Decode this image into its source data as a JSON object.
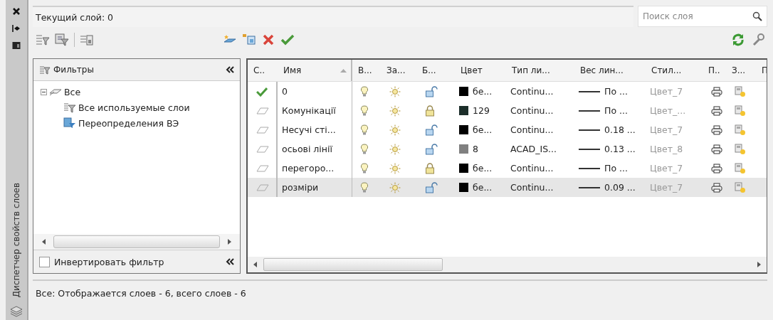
{
  "side_panel": {
    "title": "Диспетчер свойств слоев"
  },
  "current_layer": {
    "value": "Текущий слой: 0"
  },
  "search": {
    "placeholder": "Поиск слоя"
  },
  "filters": {
    "title": "Фильтры",
    "tree": [
      {
        "label": "Все",
        "kind": "all",
        "expanded": true,
        "children": [
          {
            "label": "Все используемые слои",
            "kind": "filter"
          },
          {
            "label": "Переопределения ВЭ",
            "kind": "override"
          }
        ]
      }
    ],
    "invert": {
      "label": "Инвертировать фильтр",
      "checked": false
    }
  },
  "table": {
    "columns": [
      "С..",
      "Имя",
      "В...",
      "За...",
      "Б...",
      "Цвет",
      "Тип ли...",
      "Вес лин...",
      "Стил...",
      "П..",
      "З...",
      "П"
    ],
    "rows": [
      {
        "kind": "current",
        "name": "0",
        "on": true,
        "frozen": false,
        "locked": false,
        "color": "#000000",
        "color_label": "бе...",
        "linetype": "Continu...",
        "lineweight": "По ...",
        "plot_style": "Цвет_7",
        "plot": true,
        "selected": false
      },
      {
        "kind": "layer",
        "name": "Комунікації",
        "on": true,
        "frozen": false,
        "locked": true,
        "color": "#1c2e2a",
        "color_label": "129",
        "linetype": "Continu...",
        "lineweight": "По ...",
        "plot_style": "Цвет_...",
        "plot": true,
        "selected": false
      },
      {
        "kind": "layer",
        "name": "Несучі сті...",
        "on": true,
        "frozen": false,
        "locked": false,
        "color": "#000000",
        "color_label": "бе...",
        "linetype": "Continu...",
        "lineweight": "0.18 ...",
        "plot_style": "Цвет_7",
        "plot": true,
        "selected": false
      },
      {
        "kind": "layer",
        "name": "осьові лінії",
        "on": true,
        "frozen": false,
        "locked": false,
        "color": "#808080",
        "color_label": "8",
        "linetype": "ACAD_IS...",
        "lineweight": "0.13 ...",
        "plot_style": "Цвет_8",
        "plot": true,
        "selected": false
      },
      {
        "kind": "layer",
        "name": "перегоро...",
        "on": true,
        "frozen": false,
        "locked": true,
        "color": "#000000",
        "color_label": "бе...",
        "linetype": "Continu...",
        "lineweight": "По ...",
        "plot_style": "Цвет_7",
        "plot": true,
        "selected": false
      },
      {
        "kind": "layer",
        "name": "розміри",
        "on": true,
        "frozen": false,
        "locked": false,
        "color": "#000000",
        "color_label": "бе...",
        "linetype": "Continu...",
        "lineweight": "0.09 ...",
        "plot_style": "Цвет_7",
        "plot": true,
        "selected": true
      }
    ]
  },
  "status_bar": {
    "text": "Все: Отображается слоев - 6, всего слоев - 6"
  }
}
